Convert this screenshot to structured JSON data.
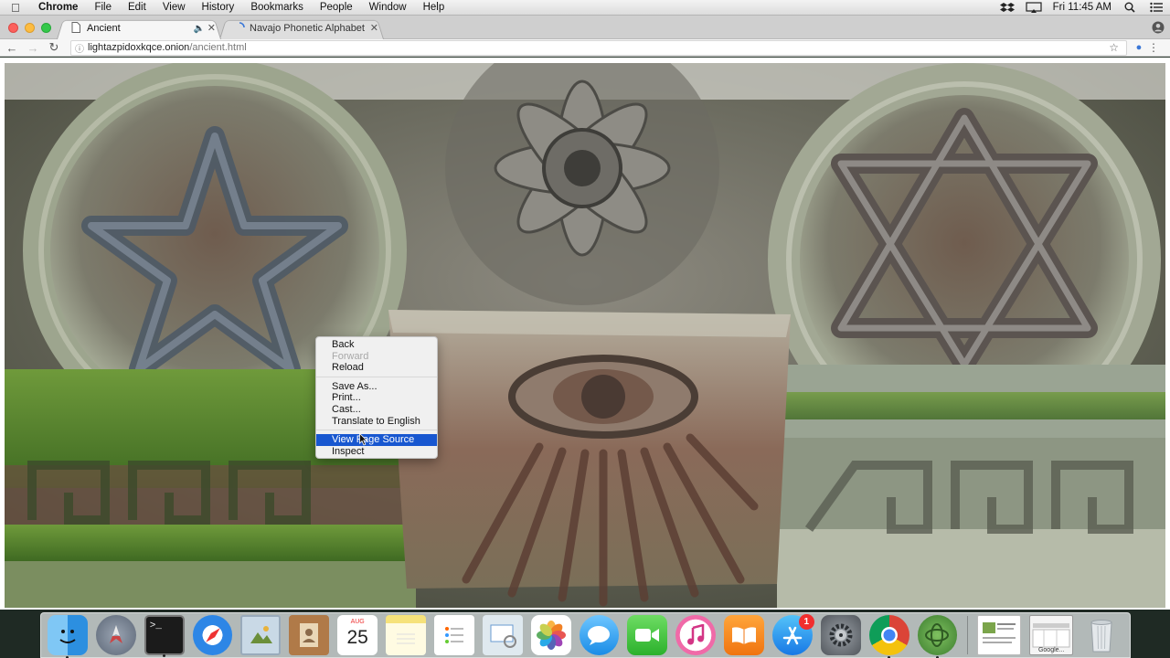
{
  "menubar": {
    "app_name": "Chrome",
    "menus": [
      "File",
      "Edit",
      "View",
      "History",
      "Bookmarks",
      "People",
      "Window",
      "Help"
    ],
    "clock": "Fri 11:45 AM"
  },
  "tabs": [
    {
      "title": "Ancient",
      "active": true
    },
    {
      "title": "Navajo Phonetic Alphabet",
      "active": false
    }
  ],
  "omnibox": {
    "host": "lightazpidoxkqce.onion",
    "path": "/ancient.html"
  },
  "context_menu": {
    "groups": [
      [
        {
          "label": "Back",
          "enabled": true
        },
        {
          "label": "Forward",
          "enabled": false
        },
        {
          "label": "Reload",
          "enabled": true
        }
      ],
      [
        {
          "label": "Save As...",
          "enabled": true
        },
        {
          "label": "Print...",
          "enabled": true
        },
        {
          "label": "Cast...",
          "enabled": true
        },
        {
          "label": "Translate to English",
          "enabled": true
        }
      ],
      [
        {
          "label": "View Page Source",
          "enabled": true,
          "highlighted": true
        },
        {
          "label": "Inspect",
          "enabled": true
        }
      ]
    ]
  },
  "dock": {
    "calendar": {
      "month": "AUG",
      "day": "25"
    },
    "app_store_badge": "1",
    "thumbnail_caption": "Google..."
  },
  "colors": {
    "highlight": "#1857d0",
    "badge": "#f12e2e"
  }
}
